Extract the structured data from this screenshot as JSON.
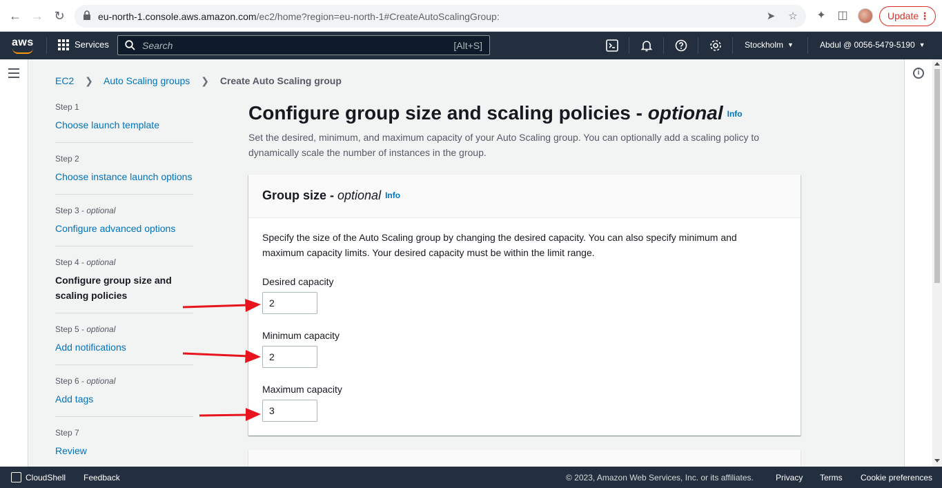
{
  "browser": {
    "url_host": "eu-north-1.console.aws.amazon.com",
    "url_path": "/ec2/home?region=eu-north-1#CreateAutoScalingGroup:",
    "update_label": "Update"
  },
  "aws_nav": {
    "logo": "aws",
    "services_label": "Services",
    "search_placeholder": "Search",
    "search_shortcut": "[Alt+S]",
    "region": "Stockholm",
    "account": "Abdul @ 0056-5479-5190"
  },
  "breadcrumb": {
    "items": [
      "EC2",
      "Auto Scaling groups"
    ],
    "current": "Create Auto Scaling group"
  },
  "steps": [
    {
      "num": "Step 1",
      "optional": "",
      "label": "Choose launch template"
    },
    {
      "num": "Step 2",
      "optional": "",
      "label": "Choose instance launch options"
    },
    {
      "num": "Step 3 - ",
      "optional": "optional",
      "label": "Configure advanced options"
    },
    {
      "num": "Step 4 - ",
      "optional": "optional",
      "label": "Configure group size and scaling policies"
    },
    {
      "num": "Step 5 - ",
      "optional": "optional",
      "label": "Add notifications"
    },
    {
      "num": "Step 6 - ",
      "optional": "optional",
      "label": "Add tags"
    },
    {
      "num": "Step 7",
      "optional": "",
      "label": "Review"
    }
  ],
  "page": {
    "title": "Configure group size and scaling policies - ",
    "title_optional": "optional",
    "info": "Info",
    "description": "Set the desired, minimum, and maximum capacity of your Auto Scaling group. You can optionally add a scaling policy to dynamically scale the number of instances in the group."
  },
  "group_size": {
    "title": "Group size - ",
    "title_optional": "optional",
    "info": "Info",
    "description": "Specify the size of the Auto Scaling group by changing the desired capacity. You can also specify minimum and maximum capacity limits. Your desired capacity must be within the limit range.",
    "desired_label": "Desired capacity",
    "desired_value": "2",
    "minimum_label": "Minimum capacity",
    "minimum_value": "2",
    "maximum_label": "Maximum capacity",
    "maximum_value": "3"
  },
  "footer": {
    "cloudshell": "CloudShell",
    "feedback": "Feedback",
    "copyright": "© 2023, Amazon Web Services, Inc. or its affiliates.",
    "privacy": "Privacy",
    "terms": "Terms",
    "cookies": "Cookie preferences"
  },
  "colors": {
    "link": "#0073bb",
    "nav_bg": "#232f3e",
    "accent_orange": "#ff9900",
    "annotation_arrow": "#e8141e"
  }
}
